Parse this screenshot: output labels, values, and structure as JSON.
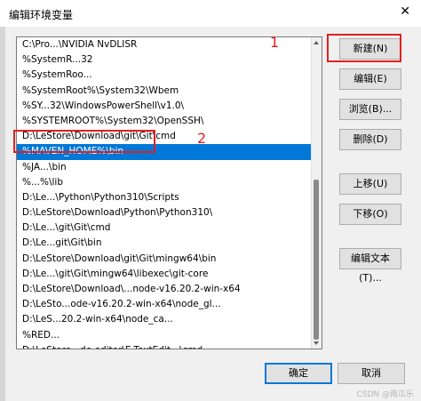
{
  "window": {
    "title": "编辑环境变量",
    "close_glyph": "✕"
  },
  "paths": [
    "C:\\Pro...\\NVIDIA NvDLISR",
    "%SystemR...32",
    "%SystemRoo...",
    "%SystemRoot%\\System32\\Wbem",
    "%SY...32\\WindowsPowerShell\\v1.0\\",
    "%SYSTEMROOT%\\System32\\OpenSSH\\",
    "D:\\LeStore\\Download\\git\\Git\\cmd",
    "%MAVEN_HOME%\\bin",
    "%JA...\\bin",
    "%...%\\lib",
    "D:\\Le...\\Python\\Python310\\Scripts",
    "D:\\LeStore\\Download\\Python\\Python310\\",
    "D:\\Le...\\git\\Git\\cmd",
    "D:\\Le...git\\Git\\bin",
    "D:\\LeStore\\Download\\git\\Git\\mingw64\\bin",
    "D:\\Le...\\git\\Git\\mingw64\\libexec\\git-core",
    "D:\\LeStore\\Download\\...node-v16.20.2-win-x64",
    "D:\\LeSto...ode-v16.20.2-win-x64\\node_gl...",
    "D:\\LeS...20.2-win-x64\\node_ca...",
    "%RED...",
    "D:\\LeStore...de editor\\E-TextEdit...\\cmd"
  ],
  "selected_index": 7,
  "buttons": {
    "new": "新建(N)",
    "edit": "编辑(E)",
    "browse": "浏览(B)...",
    "delete": "删除(D)",
    "move_up": "上移(U)",
    "move_down": "下移(O)",
    "edit_text": "编辑文本(T)...",
    "ok": "确定",
    "cancel": "取消"
  },
  "annotations": {
    "one": "1",
    "two": "2",
    "color": "#e02020"
  },
  "watermark": "CSDN @南瓜乐"
}
